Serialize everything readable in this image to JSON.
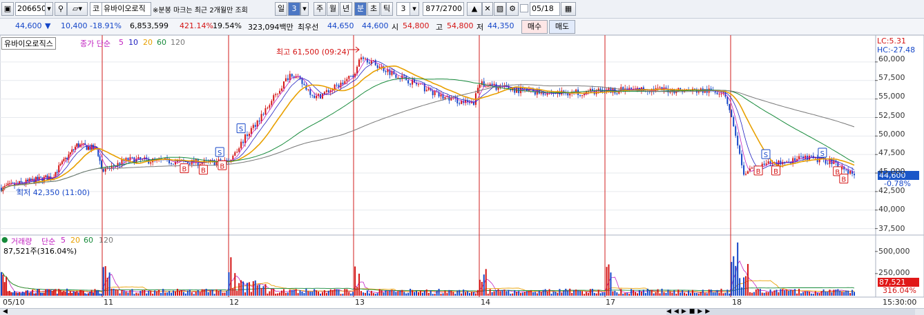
{
  "toolbar": {
    "code": "206650",
    "type_label": "코",
    "stock_name": "유바이오로직",
    "notice": "※분봉 마크는 최근 2개월만 조회",
    "periods": [
      "일",
      "3",
      "주",
      "월",
      "년",
      "분",
      "초",
      "틱"
    ],
    "active_period": "분",
    "interval_value": "3",
    "count": "877/2700",
    "date_value": "05/18"
  },
  "infobar": {
    "price": "44,600",
    "change": "10,400",
    "change_pct": "-18.91%",
    "volume": "6,853,599",
    "vol_ratio": "421.14%",
    "turnover_rate": "19.54%",
    "trade_value": "323,094백만",
    "best_label": "최우선",
    "best_ask": "44,650",
    "best_bid": "44,600",
    "open_label": "시",
    "open": "54,800",
    "high_label": "고",
    "high": "54,800",
    "low_label": "저",
    "low": "44,350",
    "buy_label": "매수",
    "sell_label": "매도"
  },
  "colors": {
    "up": "#d41414",
    "down": "#1546c8",
    "ma5": "#c020c0",
    "ma10": "#2020c0",
    "ma20": "#e8a000",
    "ma60": "#168a3a",
    "ma120": "#777777",
    "session_line": "#d21e1e"
  },
  "price_panel": {
    "stock_label": "유바이오로직스",
    "ma_title": "종가 단순",
    "ma_periods": [
      "5",
      "10",
      "20",
      "60",
      "120"
    ],
    "max_label": "최고 61,500 (09:24)",
    "min_label": "최저 42,350 (11:00)",
    "lc_label": "LC:5.31",
    "hc_label": "HC:-27.48",
    "current_price_tag": "44,600",
    "current_pct_tag": "-0.78%",
    "y_ticks": [
      "60,000",
      "57,500",
      "55,000",
      "52,500",
      "50,000",
      "47,500",
      "45,000",
      "42,500",
      "40,000",
      "37,500"
    ]
  },
  "volume_panel": {
    "label": "거래량",
    "ma_title": "단순",
    "ma_periods": [
      "5",
      "20",
      "60",
      "120"
    ],
    "current_label": "87,521주(316.04%)",
    "y_ticks": [
      "500,000",
      "250,000"
    ],
    "current_tag": "87,521",
    "current_pct_tag": "316.04%"
  },
  "x_axis": {
    "labels": [
      "05/10",
      "11",
      "12",
      "13",
      "14",
      "17",
      "18"
    ],
    "time_label": "15:30:00"
  },
  "chart_data": {
    "type": "candlestick",
    "y_range": [
      37000,
      62500
    ],
    "sessions": [
      "05/10",
      "11",
      "12",
      "13",
      "14",
      "17",
      "18"
    ],
    "close_path": [
      [
        0,
        43000
      ],
      [
        0.2,
        43600
      ],
      [
        0.5,
        44500
      ],
      [
        0.75,
        48800
      ],
      [
        0.95,
        48200
      ],
      [
        1.0,
        45200
      ],
      [
        1.2,
        46800
      ],
      [
        1.5,
        46600
      ],
      [
        1.8,
        46400
      ],
      [
        2.0,
        46600
      ],
      [
        2.15,
        50200
      ],
      [
        2.3,
        53600
      ],
      [
        2.5,
        58600
      ],
      [
        2.7,
        55200
      ],
      [
        2.9,
        57000
      ],
      [
        3.0,
        58200
      ],
      [
        3.05,
        61000
      ],
      [
        3.2,
        59400
      ],
      [
        3.5,
        57000
      ],
      [
        3.7,
        55300
      ],
      [
        3.95,
        54200
      ],
      [
        4.0,
        57000
      ],
      [
        4.3,
        56200
      ],
      [
        4.6,
        55800
      ],
      [
        4.9,
        56000
      ],
      [
        5.0,
        56100
      ],
      [
        5.3,
        56300
      ],
      [
        5.6,
        56200
      ],
      [
        5.95,
        56000
      ],
      [
        6.0,
        53000
      ],
      [
        6.1,
        45000
      ],
      [
        6.3,
        46200
      ],
      [
        6.6,
        47000
      ],
      [
        6.8,
        46600
      ],
      [
        7.0,
        44600
      ]
    ],
    "buy_markers": [
      [
        1.65,
        45600
      ],
      [
        1.8,
        45400
      ],
      [
        1.95,
        46000
      ],
      [
        6.22,
        45300
      ],
      [
        6.36,
        45300
      ],
      [
        6.85,
        45200
      ],
      [
        6.9,
        44200
      ]
    ],
    "sell_markers": [
      [
        1.93,
        47800
      ],
      [
        2.1,
        51000
      ],
      [
        6.28,
        47500
      ],
      [
        6.73,
        47700
      ]
    ],
    "volume_y_ticks": [
      500000,
      250000
    ],
    "current_volume": 87521
  }
}
